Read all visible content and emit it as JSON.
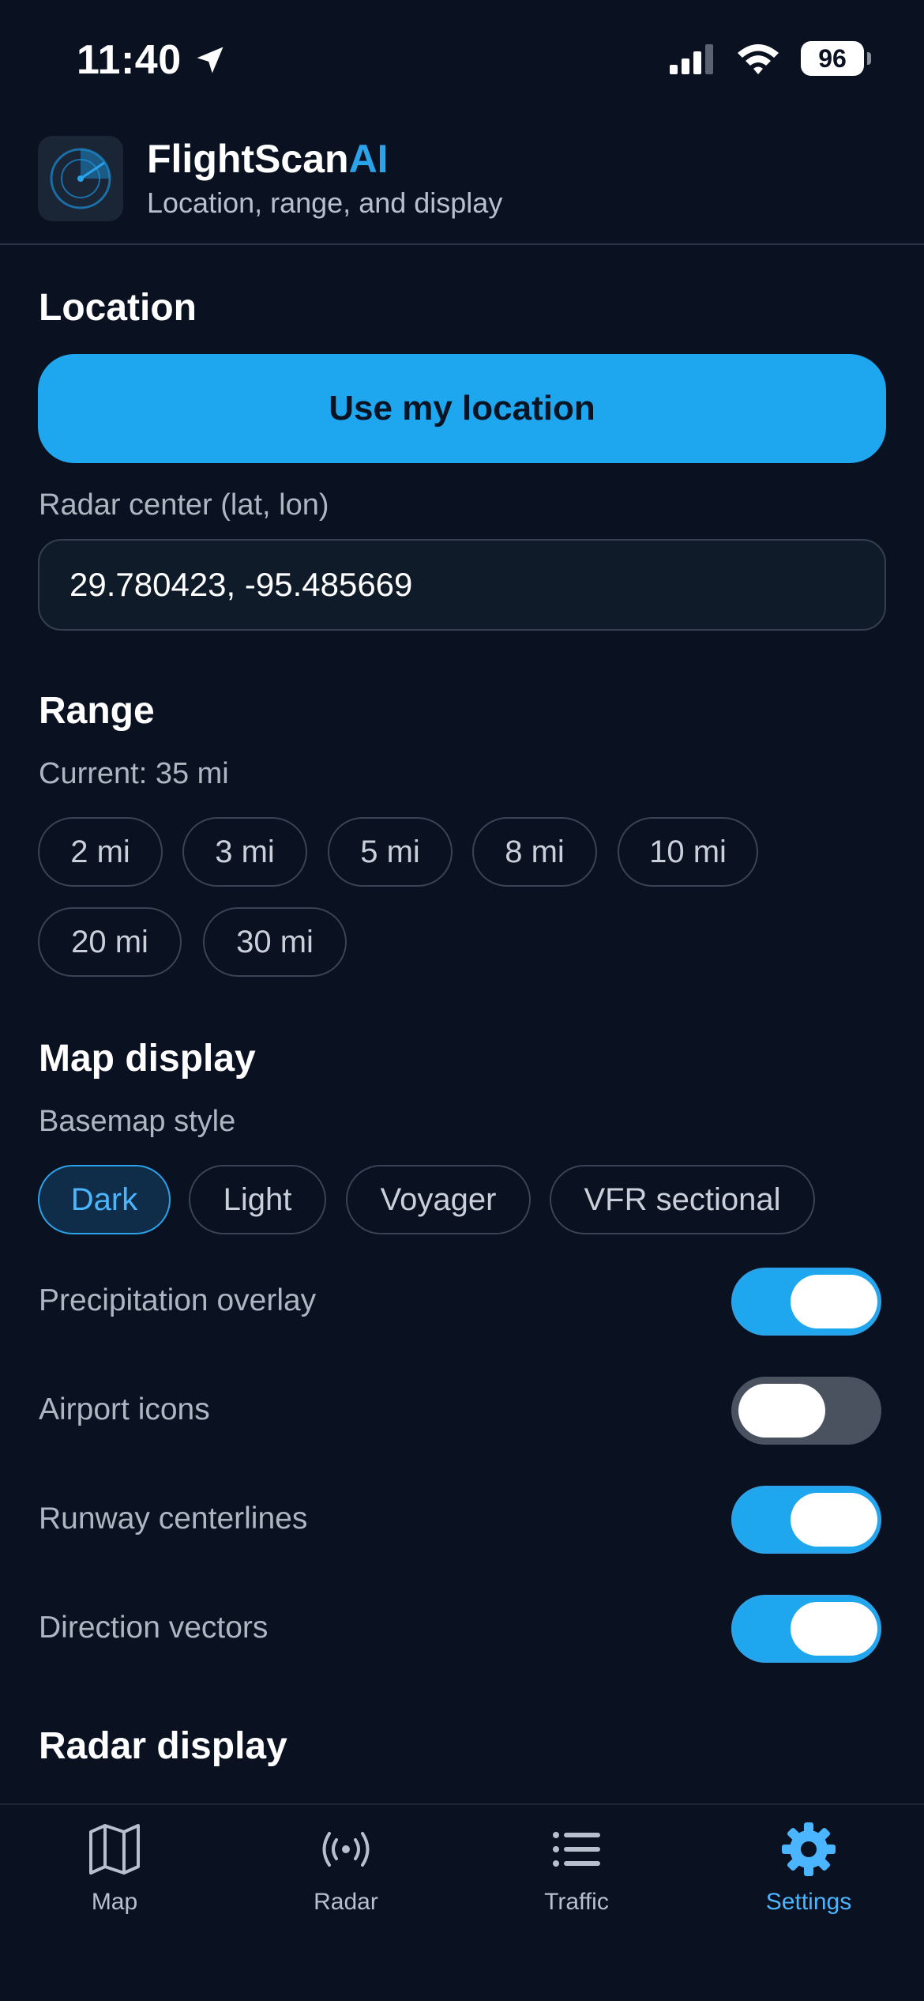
{
  "status_bar": {
    "time": "11:40",
    "battery": "96"
  },
  "header": {
    "title_main": "FlightScan",
    "title_accent": "AI",
    "subtitle": "Location, range, and display"
  },
  "location": {
    "title": "Location",
    "use_location_label": "Use my location",
    "field_label": "Radar center (lat, lon)",
    "field_value": "29.780423, -95.485669"
  },
  "range": {
    "title": "Range",
    "current": "Current: 35 mi",
    "options": [
      "2 mi",
      "3 mi",
      "5 mi",
      "8 mi",
      "10 mi",
      "20 mi",
      "30 mi"
    ]
  },
  "map_display": {
    "title": "Map display",
    "basemap_label": "Basemap style",
    "basemap_options": [
      "Dark",
      "Light",
      "Voyager",
      "VFR sectional"
    ],
    "basemap_selected": "Dark",
    "toggles": [
      {
        "label": "Precipitation overlay",
        "on": true
      },
      {
        "label": "Airport icons",
        "on": false
      },
      {
        "label": "Runway centerlines",
        "on": true
      },
      {
        "label": "Direction vectors",
        "on": true
      }
    ]
  },
  "radar_display": {
    "title": "Radar display"
  },
  "tabs": [
    {
      "label": "Map",
      "icon": "map-icon",
      "active": false
    },
    {
      "label": "Radar",
      "icon": "radar-icon",
      "active": false
    },
    {
      "label": "Traffic",
      "icon": "list-icon",
      "active": false
    },
    {
      "label": "Settings",
      "icon": "gear-icon",
      "active": true
    }
  ],
  "colors": {
    "background": "#0a1120",
    "accent": "#1ea6ee",
    "toggle_off": "#4a5260"
  }
}
